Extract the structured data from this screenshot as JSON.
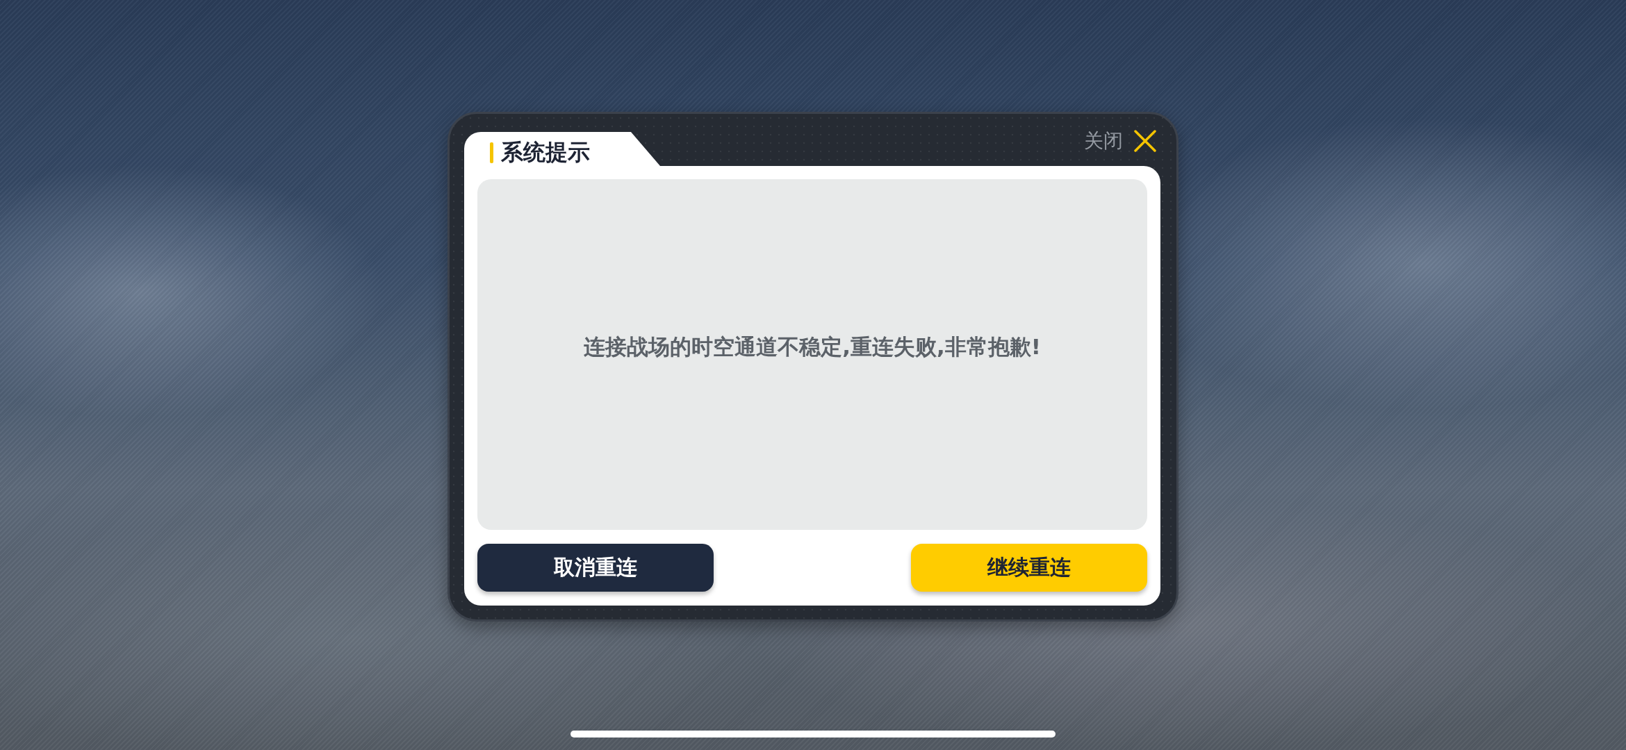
{
  "dialog": {
    "title": "系统提示",
    "close_label": "关闭",
    "message": "连接战场的时空通道不稳定,重连失败,非常抱歉!",
    "buttons": [
      {
        "label": "取消重连",
        "kind": "secondary"
      },
      {
        "label": "继续重连",
        "kind": "primary"
      }
    ]
  }
}
